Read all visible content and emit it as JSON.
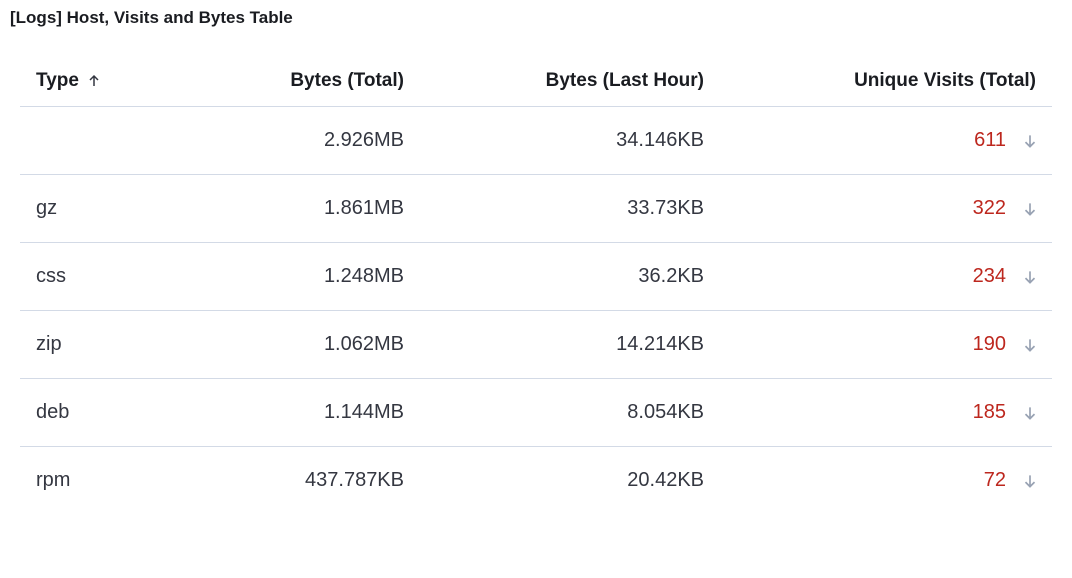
{
  "panel": {
    "title": "[Logs] Host, Visits and Bytes Table"
  },
  "columns": {
    "type": "Type",
    "bytes_total": "Bytes (Total)",
    "bytes_last_hour": "Bytes (Last Hour)",
    "unique_visits": "Unique Visits (Total)"
  },
  "sort": {
    "column": "type",
    "direction": "asc"
  },
  "rows": [
    {
      "type": "",
      "bytes_total": "2.926MB",
      "bytes_last_hour": "34.146KB",
      "unique_visits": "611",
      "trend": "down"
    },
    {
      "type": "gz",
      "bytes_total": "1.861MB",
      "bytes_last_hour": "33.73KB",
      "unique_visits": "322",
      "trend": "down"
    },
    {
      "type": "css",
      "bytes_total": "1.248MB",
      "bytes_last_hour": "36.2KB",
      "unique_visits": "234",
      "trend": "down"
    },
    {
      "type": "zip",
      "bytes_total": "1.062MB",
      "bytes_last_hour": "14.214KB",
      "unique_visits": "190",
      "trend": "down"
    },
    {
      "type": "deb",
      "bytes_total": "1.144MB",
      "bytes_last_hour": "8.054KB",
      "unique_visits": "185",
      "trend": "down"
    },
    {
      "type": "rpm",
      "bytes_total": "437.787KB",
      "bytes_last_hour": "20.42KB",
      "unique_visits": "72",
      "trend": "down"
    }
  ]
}
